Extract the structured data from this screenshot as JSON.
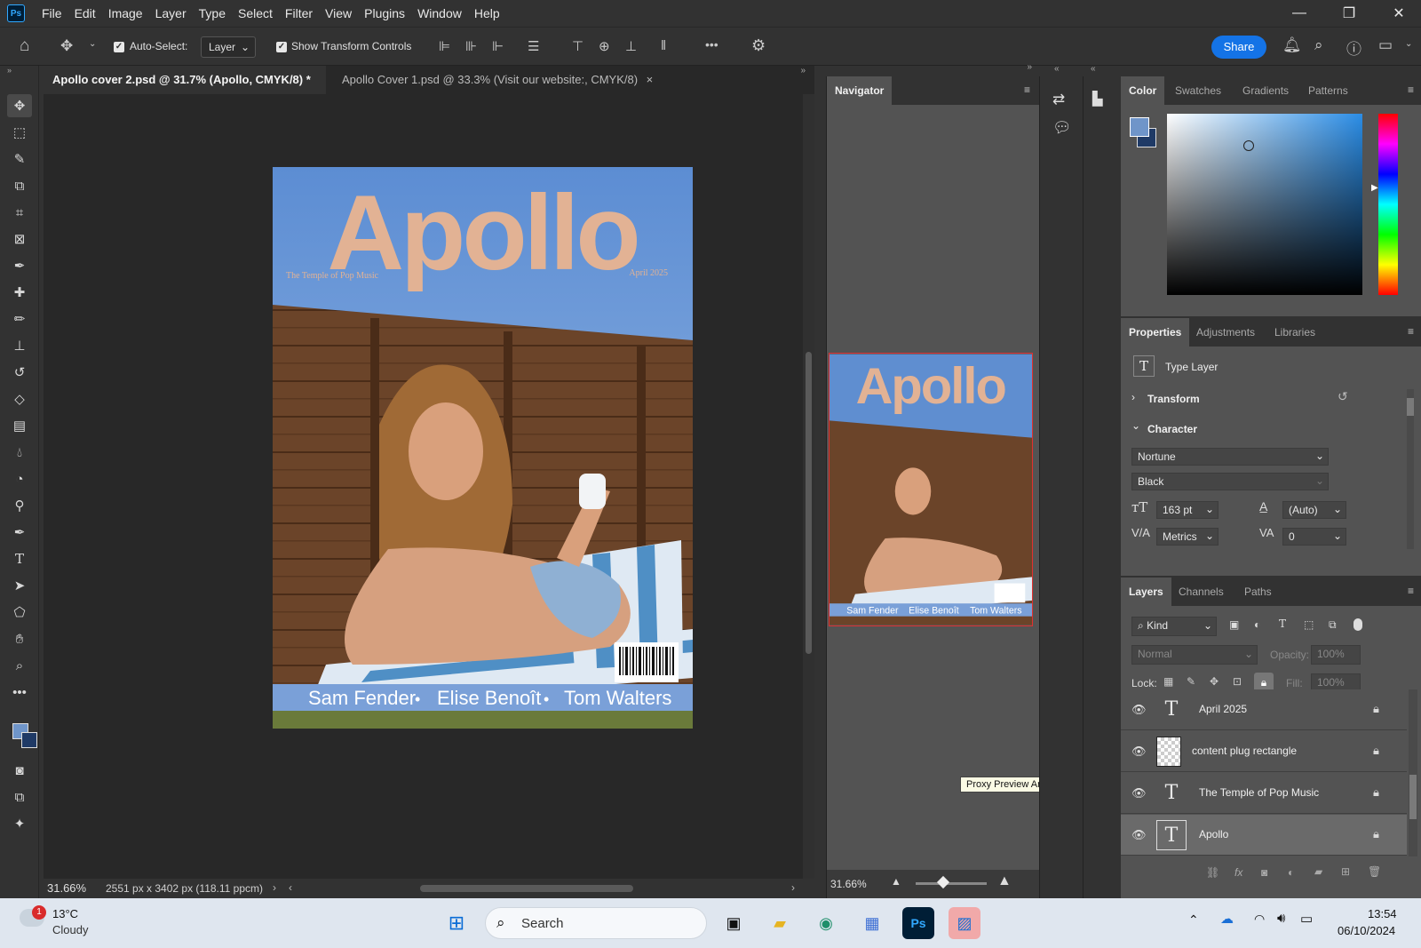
{
  "app": {
    "logo": "Ps"
  },
  "menu": [
    "File",
    "Edit",
    "Image",
    "Layer",
    "Type",
    "Select",
    "Filter",
    "View",
    "Plugins",
    "Window",
    "Help"
  ],
  "window_controls": {
    "minimize": "—",
    "restore": "❐",
    "close": "✕"
  },
  "options": {
    "auto_select_label": "Auto-Select:",
    "auto_select_value": "Layer",
    "show_transform_label": "Show Transform Controls",
    "more": "•••",
    "share": "Share"
  },
  "tabs": [
    {
      "label": "Apollo cover 2.psd @ 31.7% (Apollo, CMYK/8) *",
      "close": "×"
    },
    {
      "label": "Apollo Cover 1.psd @ 33.3% (Visit our website:, CMYK/8)",
      "close": "×"
    }
  ],
  "cover": {
    "title": "Apollo",
    "tagline": "The Temple of Pop Music",
    "date": "April 2025",
    "names": [
      "Sam Fender",
      "Elise Benoît",
      "Tom Walters"
    ],
    "separator": "•"
  },
  "status": {
    "zoom": "31.66%",
    "doc_size": "2551 px x 3402 px (118.11 ppcm)"
  },
  "navigator": {
    "title": "Navigator",
    "zoom": "31.66%",
    "tooltip": "Proxy Preview Area"
  },
  "color_panel": {
    "tabs": [
      "Color",
      "Swatches",
      "Gradients",
      "Patterns"
    ],
    "foreground": "#6f95c9",
    "background": "#1f3a66"
  },
  "properties": {
    "tabs": [
      "Properties",
      "Adjustments",
      "Libraries"
    ],
    "layer_type": "Type Layer",
    "transform_label": "Transform",
    "character_label": "Character",
    "font_family": "Nortune",
    "font_style": "Black",
    "font_size": "163 pt",
    "leading": "(Auto)",
    "kerning": "Metrics",
    "tracking": "0"
  },
  "layers": {
    "tabs": [
      "Layers",
      "Channels",
      "Paths"
    ],
    "filter_kind": "Kind",
    "blend_mode": "Normal",
    "opacity_label": "Opacity:",
    "opacity_value": "100%",
    "lock_label": "Lock:",
    "fill_label": "Fill:",
    "fill_value": "100%",
    "items": [
      {
        "name": "April 2025",
        "kind": "text",
        "selected": false
      },
      {
        "name": "content plug rectangle",
        "kind": "smart",
        "selected": false
      },
      {
        "name": "The Temple of Pop Music",
        "kind": "text",
        "selected": false
      },
      {
        "name": "Apollo",
        "kind": "text",
        "selected": true
      }
    ]
  },
  "taskbar": {
    "weather_temp": "13°C",
    "weather_desc": "Cloudy",
    "notif_count": "1",
    "search_placeholder": "Search",
    "time": "13:54",
    "date": "06/10/2024"
  },
  "colors": {
    "cover_sky": "#5f8ed0",
    "title_color": "#e2b294",
    "names_band": "#7aa0d8"
  }
}
